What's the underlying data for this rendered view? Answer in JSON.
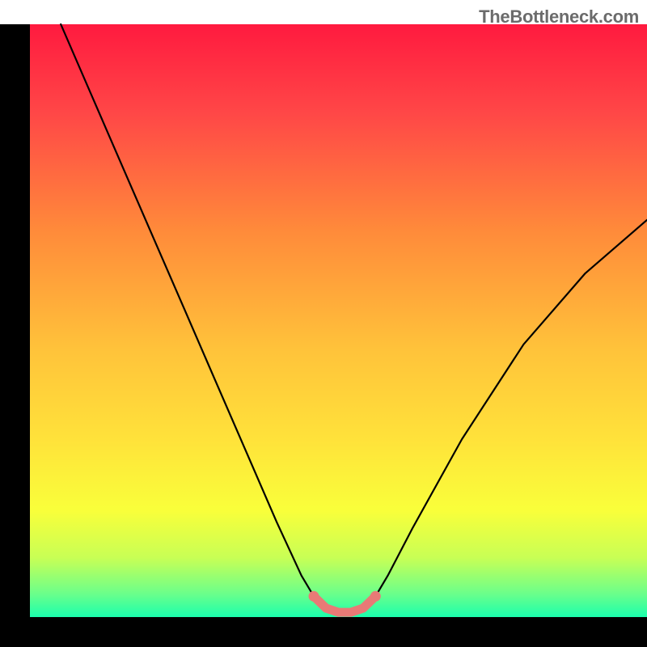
{
  "watermark": "TheBottleneck.com",
  "chart_data": {
    "type": "line",
    "title": "",
    "xlabel": "",
    "ylabel": "",
    "xlim": [
      0,
      100
    ],
    "ylim": [
      0,
      100
    ],
    "notes": "Bottleneck percentage curve over a red-to-green vertical gradient background. Axes are solid black bars with no ticks or labels. Curve has a V-shape with a flat minimum region highlighted in a salmon color near x≈48–55.",
    "series": [
      {
        "name": "bottleneck-curve",
        "x": [
          5,
          10,
          15,
          20,
          25,
          30,
          35,
          40,
          44,
          46,
          48,
          50,
          52,
          54,
          56,
          58,
          62,
          70,
          80,
          90,
          100
        ],
        "y": [
          100,
          88,
          76,
          64,
          52,
          40,
          28,
          16,
          7,
          3.5,
          1.5,
          0.8,
          0.8,
          1.5,
          3.5,
          7,
          15,
          30,
          46,
          58,
          67
        ]
      },
      {
        "name": "optimal-region",
        "x": [
          46,
          48,
          50,
          52,
          54,
          56
        ],
        "y": [
          3.5,
          1.5,
          0.8,
          0.8,
          1.5,
          3.5
        ]
      }
    ],
    "gradient_stops": [
      {
        "offset": 0.0,
        "color": "#ff1a3f"
      },
      {
        "offset": 0.15,
        "color": "#ff4747"
      },
      {
        "offset": 0.35,
        "color": "#ff8b3a"
      },
      {
        "offset": 0.55,
        "color": "#ffc33a"
      },
      {
        "offset": 0.7,
        "color": "#ffe23a"
      },
      {
        "offset": 0.82,
        "color": "#f9ff3a"
      },
      {
        "offset": 0.9,
        "color": "#c8ff55"
      },
      {
        "offset": 0.96,
        "color": "#6cff8a"
      },
      {
        "offset": 1.0,
        "color": "#1bffad"
      }
    ],
    "frame": {
      "left_bar_width": 37,
      "bottom_bar_height": 37,
      "color": "#000000"
    }
  }
}
